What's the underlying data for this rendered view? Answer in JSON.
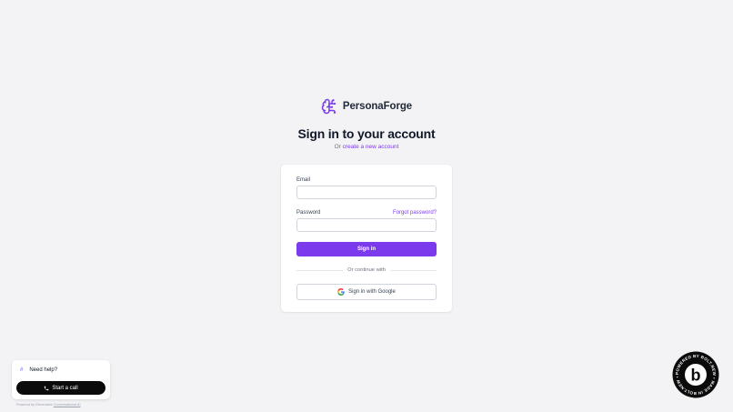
{
  "brand": {
    "name": "PersonaForge",
    "accent": "#7c3aed"
  },
  "page": {
    "title": "Sign in to your account",
    "subtitle_prefix": "Or",
    "subtitle_link": "create a new account"
  },
  "form": {
    "email_label": "Email",
    "email_value": "",
    "password_label": "Password",
    "password_value": "",
    "forgot_link": "Forgot password?",
    "submit_label": "Sign in",
    "divider_text": "Or continue with",
    "google_label": "Sign in with Google"
  },
  "widget": {
    "icon": "hash-icon",
    "title": "Need help?",
    "call_label": "Start a call",
    "footer_prefix": "Powered by Elevenlabs",
    "footer_link": "Conversational AI"
  },
  "badge": {
    "ring_text": "POWERED BY BOLT.NEW • MADE IN BOLT.NEW • ",
    "letter": "b"
  }
}
